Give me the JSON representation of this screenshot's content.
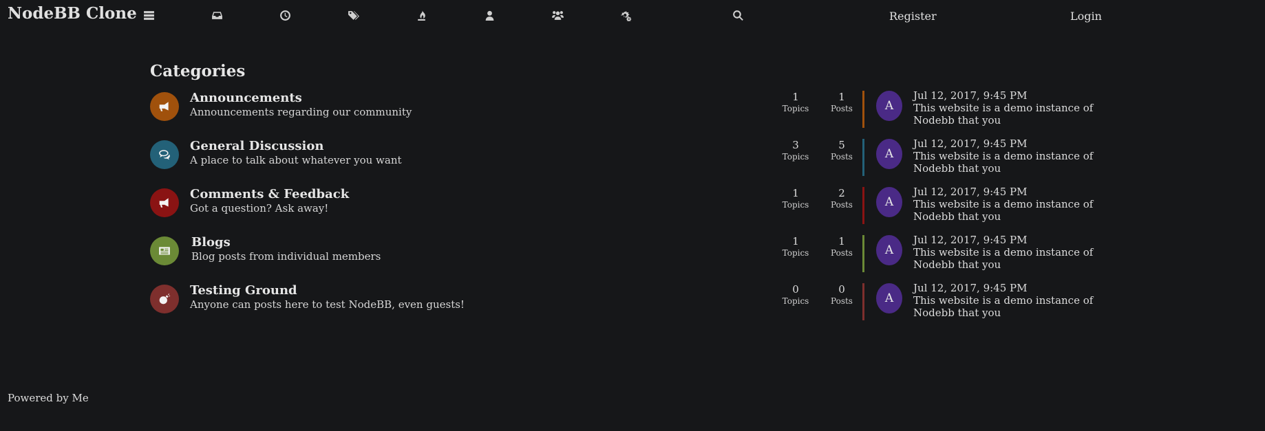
{
  "header": {
    "brand": "NodeBB Clone",
    "nav_icons": [
      "list-icon",
      "inbox-icon",
      "clock-icon",
      "tags-icon",
      "fire-icon",
      "user-icon",
      "group-icon",
      "cogs-icon",
      "search-icon"
    ],
    "register_label": "Register",
    "login_label": "Login"
  },
  "main": {
    "heading": "Categories",
    "topics_label": "Topics",
    "posts_label": "Posts",
    "categories": [
      {
        "title": "Announcements",
        "description": "Announcements regarding our community",
        "icon": "bullhorn-icon",
        "color": "#a0510c",
        "topics": "1",
        "posts": "1",
        "last_post": {
          "avatar": "A",
          "time": "Jul 12, 2017, 9:45 PM",
          "text": "This website is a demo instance of Nodebb that you"
        }
      },
      {
        "title": "General Discussion",
        "description": "A place to talk about whatever you want",
        "icon": "comments-icon",
        "color": "#236178",
        "topics": "3",
        "posts": "5",
        "last_post": {
          "avatar": "A",
          "time": "Jul 12, 2017, 9:45 PM",
          "text": "This website is a demo instance of Nodebb that you"
        }
      },
      {
        "title": "Comments & Feedback",
        "description": "Got a question? Ask away!",
        "icon": "bullhorn-icon",
        "color": "#8a1313",
        "topics": "1",
        "posts": "2",
        "last_post": {
          "avatar": "A",
          "time": "Jul 12, 2017, 9:45 PM",
          "text": "This website is a demo instance of Nodebb that you"
        }
      },
      {
        "title": "Blogs",
        "description": "Blog posts from individual members",
        "icon": "newspaper-icon",
        "color": "#6b8a36",
        "topics": "1",
        "posts": "1",
        "last_post": {
          "avatar": "A",
          "time": "Jul 12, 2017, 9:45 PM",
          "text": "This website is a demo instance of Nodebb that you"
        }
      },
      {
        "title": "Testing Ground",
        "description": "Anyone can posts here to test NodeBB, even guests!",
        "icon": "bomb-icon",
        "color": "#7e2f2d",
        "topics": "0",
        "posts": "0",
        "last_post": {
          "avatar": "A",
          "time": "Jul 12, 2017, 9:45 PM",
          "text": "This website is a demo instance of Nodebb that you"
        }
      }
    ]
  },
  "footer": {
    "text": "Powered by Me"
  }
}
